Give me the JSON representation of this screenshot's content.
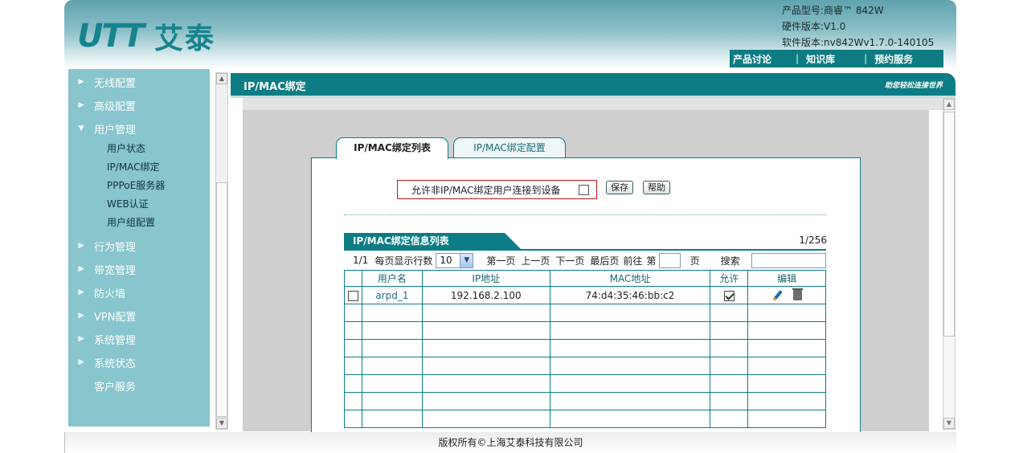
{
  "brand": {
    "logo_mark": "UTT",
    "logo_text": "艾泰"
  },
  "product": {
    "model": "产品型号:商睿™ 842W",
    "hardware": "硬件版本:V1.0",
    "software": "软件版本:nv842Wv1.7.0-140105"
  },
  "top_links": [
    "产品讨论",
    "知识库",
    "预约服务"
  ],
  "sidebar": {
    "items": [
      {
        "label": "无线配置"
      },
      {
        "label": "高级配置"
      },
      {
        "label": "用户管理"
      },
      {
        "label": "行为管理"
      },
      {
        "label": "带宽管理"
      },
      {
        "label": "防火墙"
      },
      {
        "label": "VPN配置"
      },
      {
        "label": "系统管理"
      },
      {
        "label": "系统状态"
      },
      {
        "label": "客户服务"
      }
    ],
    "subitems": [
      "用户状态",
      "IP/MAC绑定",
      "PPPoE服务器",
      "WEB认证",
      "用户组配置"
    ]
  },
  "main": {
    "title": "IP/MAC绑定",
    "slogan": "助您轻松连接世界",
    "tabs": [
      {
        "label": "IP/MAC绑定列表"
      },
      {
        "label": "IP/MAC绑定配置"
      }
    ],
    "allow_label": "允许非IP/MAC绑定用户连接到设备",
    "allow_checked": false,
    "save_label": "保存",
    "help_label": "帮助"
  },
  "list": {
    "title": "IP/MAC绑定信息列表",
    "count": "1/256",
    "page": "1/1",
    "per_page_label": "每页显示行数",
    "per_page_value": "10",
    "first": "第一页",
    "prev": "上一页",
    "next": "下一页",
    "last": "最后页",
    "goto": "前往",
    "di": "第",
    "ye": "页",
    "search_label": "搜索",
    "columns": [
      "用户名",
      "IP地址",
      "MAC地址",
      "允许",
      "编辑"
    ],
    "rows": [
      {
        "username": "arpd_1",
        "ip": "192.168.2.100",
        "mac": "74:d4:35:46:bb:c2",
        "allow": true
      }
    ]
  },
  "footer": "版权所有©上海艾泰科技有限公司",
  "colors": {
    "accent": "#0c7d84",
    "sidebar": "#88c5cd",
    "alert_border": "#c41a1a"
  }
}
